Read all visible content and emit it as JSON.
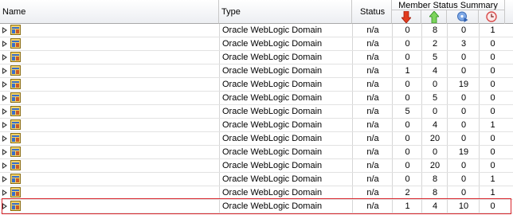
{
  "header": {
    "name": "Name",
    "type": "Type",
    "status": "Status",
    "summary": "Member Status Summary",
    "summary_icons": [
      "down-arrow-icon",
      "up-arrow-icon",
      "unknown-status-icon",
      "pending-clock-icon"
    ]
  },
  "colors": {
    "down": "#e23b1e",
    "up": "#2fa82f",
    "unknown": "#3f7ad0",
    "clock": "#e06060",
    "selection": "#d9252b"
  },
  "rows": [
    {
      "type": "Oracle WebLogic Domain",
      "status": "n/a",
      "c1": "0",
      "c2": "8",
      "c3": "0",
      "c4": "1"
    },
    {
      "type": "Oracle WebLogic Domain",
      "status": "n/a",
      "c1": "0",
      "c2": "2",
      "c3": "3",
      "c4": "0"
    },
    {
      "type": "Oracle WebLogic Domain",
      "status": "n/a",
      "c1": "0",
      "c2": "5",
      "c3": "0",
      "c4": "0"
    },
    {
      "type": "Oracle WebLogic Domain",
      "status": "n/a",
      "c1": "1",
      "c2": "4",
      "c3": "0",
      "c4": "0"
    },
    {
      "type": "Oracle WebLogic Domain",
      "status": "n/a",
      "c1": "0",
      "c2": "0",
      "c3": "19",
      "c4": "0"
    },
    {
      "type": "Oracle WebLogic Domain",
      "status": "n/a",
      "c1": "0",
      "c2": "5",
      "c3": "0",
      "c4": "0"
    },
    {
      "type": "Oracle WebLogic Domain",
      "status": "n/a",
      "c1": "5",
      "c2": "0",
      "c3": "0",
      "c4": "0"
    },
    {
      "type": "Oracle WebLogic Domain",
      "status": "n/a",
      "c1": "0",
      "c2": "4",
      "c3": "0",
      "c4": "1"
    },
    {
      "type": "Oracle WebLogic Domain",
      "status": "n/a",
      "c1": "0",
      "c2": "20",
      "c3": "0",
      "c4": "0"
    },
    {
      "type": "Oracle WebLogic Domain",
      "status": "n/a",
      "c1": "0",
      "c2": "0",
      "c3": "19",
      "c4": "0"
    },
    {
      "type": "Oracle WebLogic Domain",
      "status": "n/a",
      "c1": "0",
      "c2": "20",
      "c3": "0",
      "c4": "0"
    },
    {
      "type": "Oracle WebLogic Domain",
      "status": "n/a",
      "c1": "0",
      "c2": "8",
      "c3": "0",
      "c4": "1"
    },
    {
      "type": "Oracle WebLogic Domain",
      "status": "n/a",
      "c1": "2",
      "c2": "8",
      "c3": "0",
      "c4": "1"
    },
    {
      "type": "Oracle WebLogic Domain",
      "status": "n/a",
      "c1": "1",
      "c2": "4",
      "c3": "10",
      "c4": "0"
    }
  ]
}
